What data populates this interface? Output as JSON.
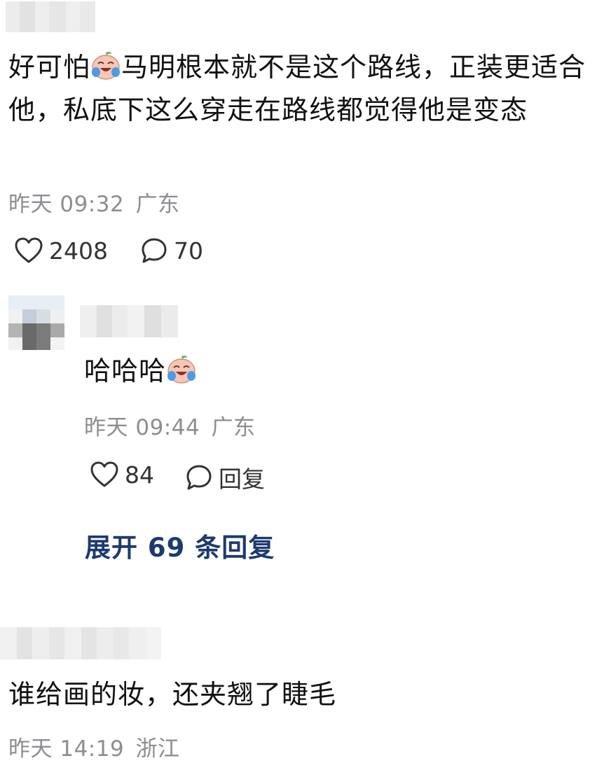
{
  "comments": [
    {
      "text_before_emoji": "好可怕",
      "text_after_emoji": "马明根本就不是这个路线，正装更适合他，私底下这么穿走在路线都觉得他是变态",
      "emoji": "crying-laughing-emoji",
      "time": "昨天 09:32",
      "location": "广东",
      "likes": "2408",
      "replies": "70"
    },
    {
      "text": "谁给画的妆，还夹翘了睫毛",
      "time": "昨天 14:19",
      "location": "浙江"
    }
  ],
  "reply": {
    "text": "哈哈哈",
    "emoji": "crying-laughing-emoji",
    "time": "昨天 09:44",
    "location": "广东",
    "likes": "84",
    "reply_label": "回复"
  },
  "expand_label": "展开 69 条回复",
  "colors": {
    "text": "#111111",
    "meta": "#8d8d92",
    "link": "#1d3a6e"
  }
}
